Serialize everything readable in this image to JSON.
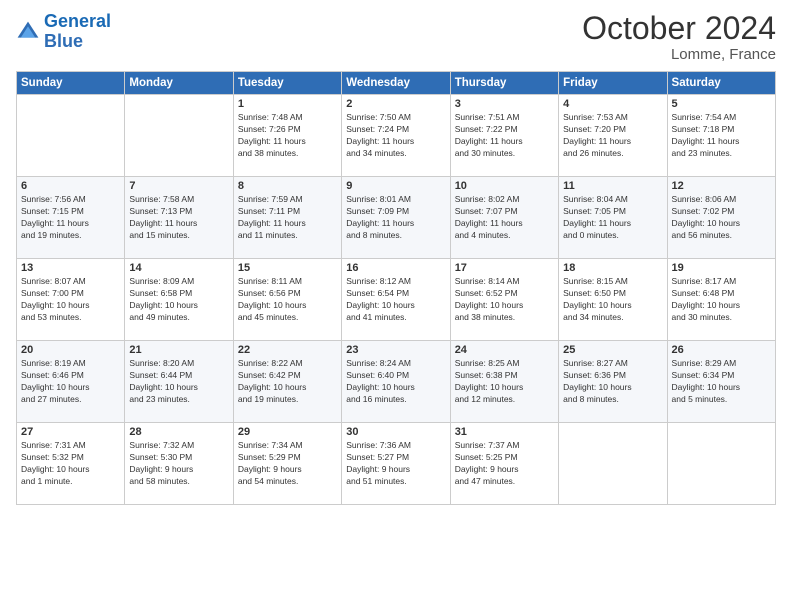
{
  "logo": {
    "line1": "General",
    "line2": "Blue"
  },
  "title": "October 2024",
  "location": "Lomme, France",
  "days_header": [
    "Sunday",
    "Monday",
    "Tuesday",
    "Wednesday",
    "Thursday",
    "Friday",
    "Saturday"
  ],
  "weeks": [
    [
      {
        "day": "",
        "info": ""
      },
      {
        "day": "",
        "info": ""
      },
      {
        "day": "1",
        "info": "Sunrise: 7:48 AM\nSunset: 7:26 PM\nDaylight: 11 hours\nand 38 minutes."
      },
      {
        "day": "2",
        "info": "Sunrise: 7:50 AM\nSunset: 7:24 PM\nDaylight: 11 hours\nand 34 minutes."
      },
      {
        "day": "3",
        "info": "Sunrise: 7:51 AM\nSunset: 7:22 PM\nDaylight: 11 hours\nand 30 minutes."
      },
      {
        "day": "4",
        "info": "Sunrise: 7:53 AM\nSunset: 7:20 PM\nDaylight: 11 hours\nand 26 minutes."
      },
      {
        "day": "5",
        "info": "Sunrise: 7:54 AM\nSunset: 7:18 PM\nDaylight: 11 hours\nand 23 minutes."
      }
    ],
    [
      {
        "day": "6",
        "info": "Sunrise: 7:56 AM\nSunset: 7:15 PM\nDaylight: 11 hours\nand 19 minutes."
      },
      {
        "day": "7",
        "info": "Sunrise: 7:58 AM\nSunset: 7:13 PM\nDaylight: 11 hours\nand 15 minutes."
      },
      {
        "day": "8",
        "info": "Sunrise: 7:59 AM\nSunset: 7:11 PM\nDaylight: 11 hours\nand 11 minutes."
      },
      {
        "day": "9",
        "info": "Sunrise: 8:01 AM\nSunset: 7:09 PM\nDaylight: 11 hours\nand 8 minutes."
      },
      {
        "day": "10",
        "info": "Sunrise: 8:02 AM\nSunset: 7:07 PM\nDaylight: 11 hours\nand 4 minutes."
      },
      {
        "day": "11",
        "info": "Sunrise: 8:04 AM\nSunset: 7:05 PM\nDaylight: 11 hours\nand 0 minutes."
      },
      {
        "day": "12",
        "info": "Sunrise: 8:06 AM\nSunset: 7:02 PM\nDaylight: 10 hours\nand 56 minutes."
      }
    ],
    [
      {
        "day": "13",
        "info": "Sunrise: 8:07 AM\nSunset: 7:00 PM\nDaylight: 10 hours\nand 53 minutes."
      },
      {
        "day": "14",
        "info": "Sunrise: 8:09 AM\nSunset: 6:58 PM\nDaylight: 10 hours\nand 49 minutes."
      },
      {
        "day": "15",
        "info": "Sunrise: 8:11 AM\nSunset: 6:56 PM\nDaylight: 10 hours\nand 45 minutes."
      },
      {
        "day": "16",
        "info": "Sunrise: 8:12 AM\nSunset: 6:54 PM\nDaylight: 10 hours\nand 41 minutes."
      },
      {
        "day": "17",
        "info": "Sunrise: 8:14 AM\nSunset: 6:52 PM\nDaylight: 10 hours\nand 38 minutes."
      },
      {
        "day": "18",
        "info": "Sunrise: 8:15 AM\nSunset: 6:50 PM\nDaylight: 10 hours\nand 34 minutes."
      },
      {
        "day": "19",
        "info": "Sunrise: 8:17 AM\nSunset: 6:48 PM\nDaylight: 10 hours\nand 30 minutes."
      }
    ],
    [
      {
        "day": "20",
        "info": "Sunrise: 8:19 AM\nSunset: 6:46 PM\nDaylight: 10 hours\nand 27 minutes."
      },
      {
        "day": "21",
        "info": "Sunrise: 8:20 AM\nSunset: 6:44 PM\nDaylight: 10 hours\nand 23 minutes."
      },
      {
        "day": "22",
        "info": "Sunrise: 8:22 AM\nSunset: 6:42 PM\nDaylight: 10 hours\nand 19 minutes."
      },
      {
        "day": "23",
        "info": "Sunrise: 8:24 AM\nSunset: 6:40 PM\nDaylight: 10 hours\nand 16 minutes."
      },
      {
        "day": "24",
        "info": "Sunrise: 8:25 AM\nSunset: 6:38 PM\nDaylight: 10 hours\nand 12 minutes."
      },
      {
        "day": "25",
        "info": "Sunrise: 8:27 AM\nSunset: 6:36 PM\nDaylight: 10 hours\nand 8 minutes."
      },
      {
        "day": "26",
        "info": "Sunrise: 8:29 AM\nSunset: 6:34 PM\nDaylight: 10 hours\nand 5 minutes."
      }
    ],
    [
      {
        "day": "27",
        "info": "Sunrise: 7:31 AM\nSunset: 5:32 PM\nDaylight: 10 hours\nand 1 minute."
      },
      {
        "day": "28",
        "info": "Sunrise: 7:32 AM\nSunset: 5:30 PM\nDaylight: 9 hours\nand 58 minutes."
      },
      {
        "day": "29",
        "info": "Sunrise: 7:34 AM\nSunset: 5:29 PM\nDaylight: 9 hours\nand 54 minutes."
      },
      {
        "day": "30",
        "info": "Sunrise: 7:36 AM\nSunset: 5:27 PM\nDaylight: 9 hours\nand 51 minutes."
      },
      {
        "day": "31",
        "info": "Sunrise: 7:37 AM\nSunset: 5:25 PM\nDaylight: 9 hours\nand 47 minutes."
      },
      {
        "day": "",
        "info": ""
      },
      {
        "day": "",
        "info": ""
      }
    ]
  ]
}
